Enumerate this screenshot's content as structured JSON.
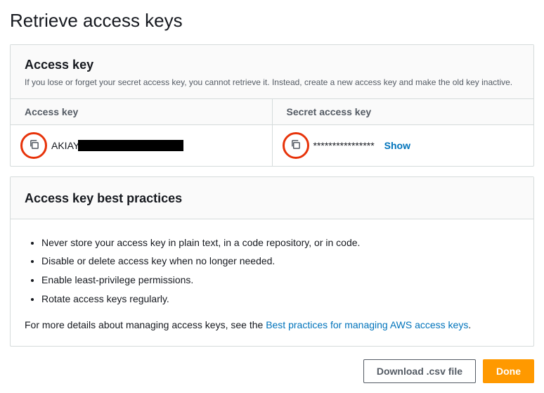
{
  "page_title": "Retrieve access keys",
  "access_key_panel": {
    "title": "Access key",
    "note": "If you lose or forget your secret access key, you cannot retrieve it. Instead, create a new access key and make the old key inactive.",
    "col1_label": "Access key",
    "col2_label": "Secret access key",
    "access_key_prefix": "AKIAY",
    "secret_masked": "****************",
    "show_label": "Show"
  },
  "best_practices": {
    "title": "Access key best practices",
    "items": [
      "Never store your access key in plain text, in a code repository, or in code.",
      "Disable or delete access key when no longer needed.",
      "Enable least-privilege permissions.",
      "Rotate access keys regularly."
    ],
    "more_prefix": "For more details about managing access keys, see the ",
    "more_link": "Best practices for managing AWS access keys",
    "more_suffix": "."
  },
  "footer": {
    "download": "Download .csv file",
    "done": "Done"
  }
}
